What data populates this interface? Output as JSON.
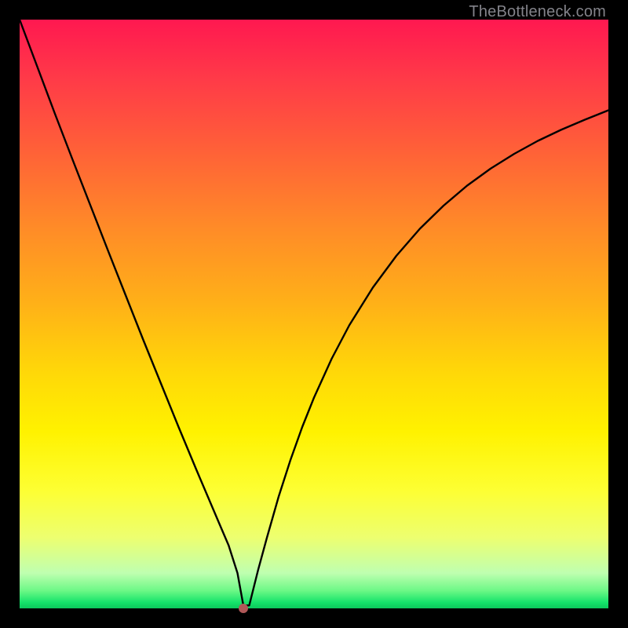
{
  "watermark": "TheBottleneck.com",
  "chart_data": {
    "type": "line",
    "title": "",
    "xlabel": "",
    "ylabel": "",
    "xlim": [
      0,
      100
    ],
    "ylim": [
      0,
      100
    ],
    "marker": {
      "x": 38,
      "y": 0,
      "color": "#b05858",
      "radius": 6
    },
    "series": [
      {
        "name": "curve",
        "x": [
          0,
          3,
          6,
          9,
          12,
          15,
          18,
          21,
          24,
          27,
          30,
          32,
          34,
          35.5,
          37,
          38,
          39,
          40.5,
          42,
          44,
          46,
          48,
          50,
          53,
          56,
          60,
          64,
          68,
          72,
          76,
          80,
          84,
          88,
          92,
          96,
          100
        ],
        "y": [
          100,
          92,
          84,
          76.2,
          68.5,
          60.8,
          53.2,
          45.6,
          38.2,
          30.8,
          23.6,
          18.9,
          14.2,
          10.7,
          6.0,
          0.5,
          0.5,
          6.5,
          12.0,
          19.0,
          25.2,
          30.8,
          35.8,
          42.4,
          48.1,
          54.5,
          59.9,
          64.5,
          68.4,
          71.8,
          74.7,
          77.2,
          79.4,
          81.3,
          83.0,
          84.6
        ]
      }
    ]
  }
}
